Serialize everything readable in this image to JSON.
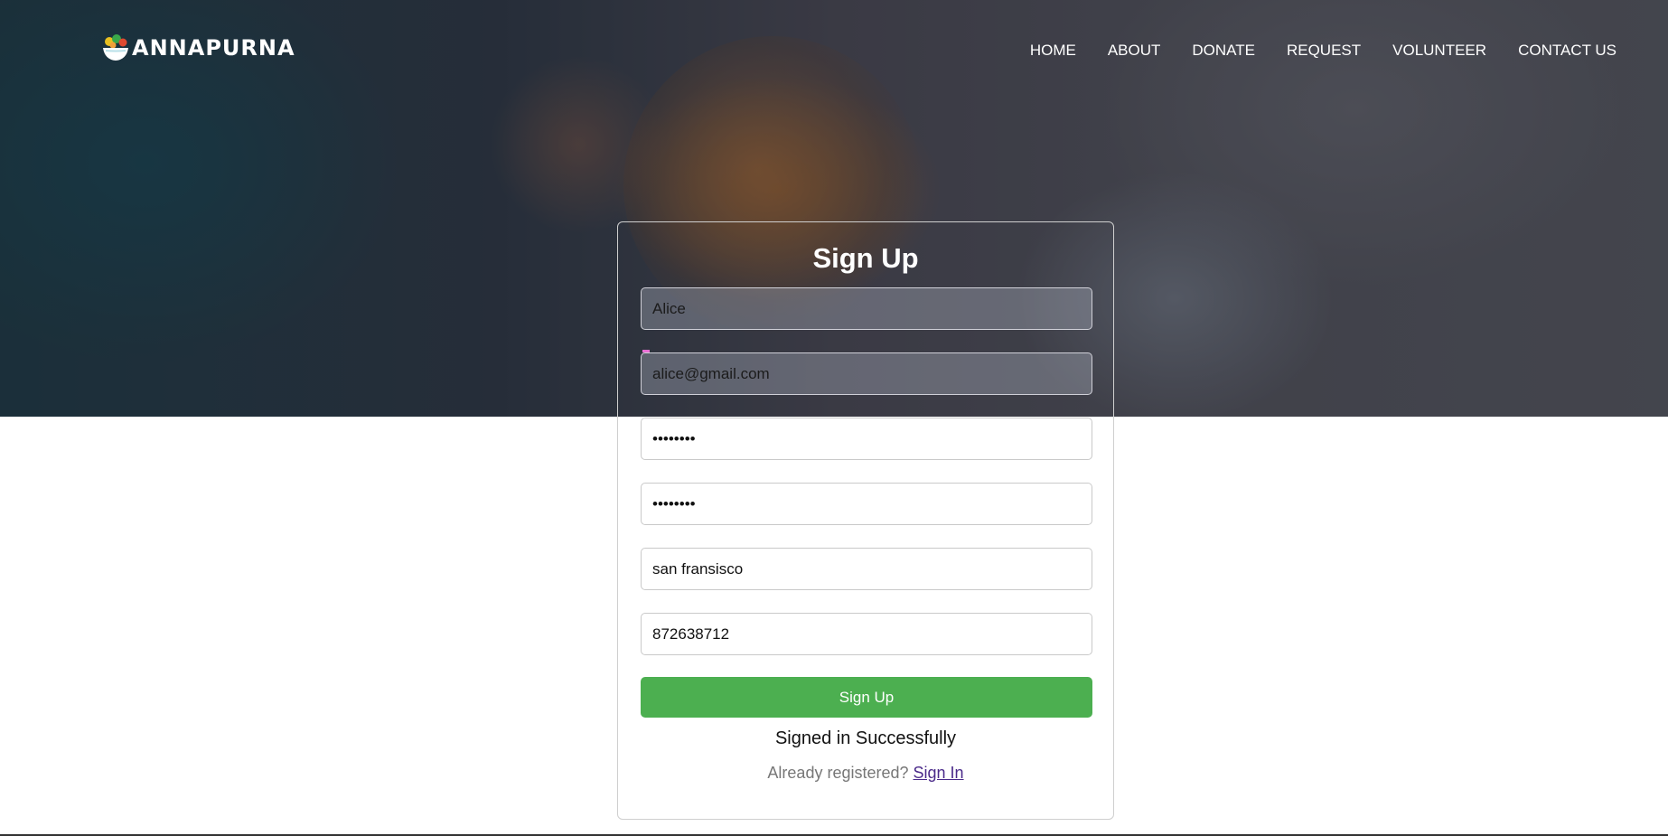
{
  "brand": {
    "name": "ANNAPURNA"
  },
  "nav": {
    "items": [
      "HOME",
      "ABOUT",
      "DONATE",
      "REQUEST",
      "VOLUNTEER",
      "CONTACT US"
    ]
  },
  "form": {
    "title": "Sign Up",
    "fields": {
      "name": "Alice",
      "email": "alice@gmail.com",
      "password": "••••••••",
      "confirm_password": "••••••••",
      "location": "san fransisco",
      "phone": "872638712"
    },
    "submit_label": "Sign Up",
    "status_message": "Signed in Successfully",
    "already_registered": "Already registered?",
    "signin_link": "Sign In"
  },
  "colors": {
    "accent": "#4caf50",
    "link": "#4b2a8a"
  },
  "icons": {
    "logo": "salad-bowl-icon"
  }
}
